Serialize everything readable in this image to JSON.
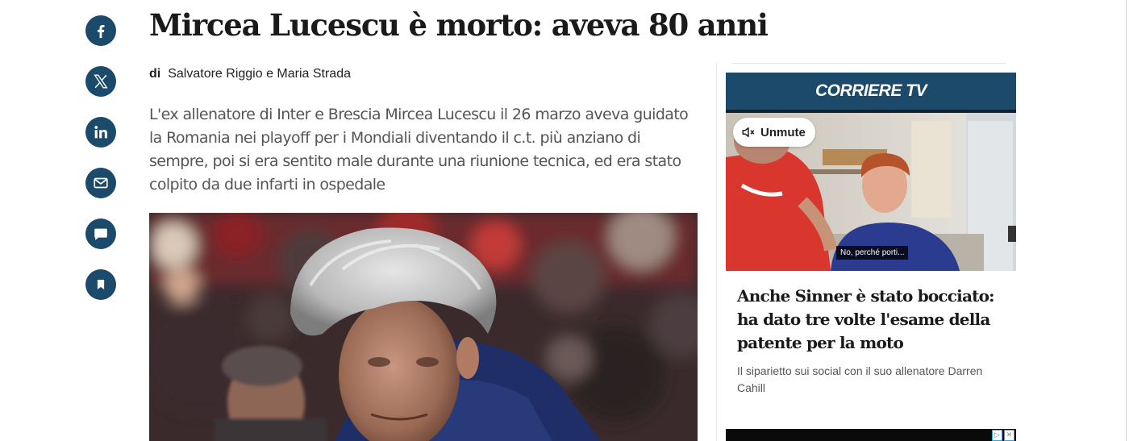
{
  "article": {
    "headline": "Mircea Lucescu è morto: aveva 80 anni",
    "byline_prefix": "di",
    "authors": "Salvatore Riggio e Maria Strada",
    "summary": "L'ex allenatore di Inter e Brescia Mircea Lucescu il 26 marzo aveva guidato la Romania nei playoff per i Mondiali diventando il c.t. più anziano di sempre, poi si era sentito male durante una riunione tecnica, ed era stato colpito da due infarti in ospedale"
  },
  "share": {
    "items": [
      {
        "icon": "facebook-icon"
      },
      {
        "icon": "x-icon"
      },
      {
        "icon": "linkedin-icon"
      },
      {
        "icon": "email-icon"
      },
      {
        "icon": "comment-icon"
      },
      {
        "icon": "bookmark-icon"
      }
    ]
  },
  "sidebar": {
    "tv_logo": "CORRIERE TV",
    "unmute_label": "Unmute",
    "video_caption": "No, perché porti...",
    "headline": "Anche Sinner è stato bocciato: ha dato tre volte l'esame della patente per la moto",
    "subheadline": "Il siparietto sui social con il suo allenatore Darren Cahill"
  },
  "colors": {
    "brand": "#1b4a6b",
    "text": "#1a1a1a",
    "muted": "#555555"
  }
}
